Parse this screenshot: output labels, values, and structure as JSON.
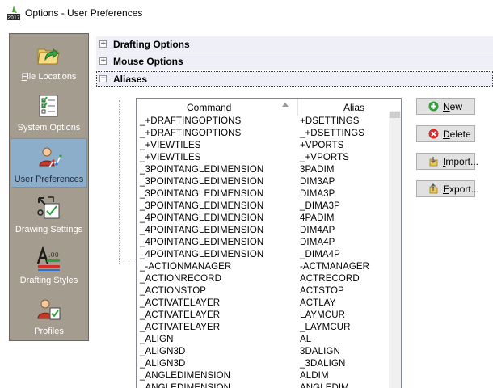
{
  "window": {
    "title": "Options - User Preferences",
    "app_icon_year": "2017",
    "app_icon": "app-logo-icon"
  },
  "sidebar": {
    "items": [
      {
        "label": "File Locations",
        "mnemonic": "F",
        "rest": "ile Locations",
        "icon": "folder-arrow-icon"
      },
      {
        "label": "System Options",
        "mnemonic": "",
        "rest": "System Options",
        "icon": "checklist-icon"
      },
      {
        "label": "User Preferences",
        "mnemonic": "U",
        "rest": "ser Preferences",
        "icon": "user-graph-icon",
        "selected": true
      },
      {
        "label": "Drawing Settings",
        "mnemonic": "",
        "rest": "Drawing Settings",
        "icon": "drawing-settings-icon"
      },
      {
        "label": "Drafting Styles",
        "mnemonic": "",
        "rest": "Drafting Styles",
        "icon": "drafting-styles-icon"
      },
      {
        "label": "Profiles",
        "mnemonic": "P",
        "rest": "rofiles",
        "icon": "profile-icon"
      }
    ]
  },
  "groups": {
    "drafting_options": "Drafting Options",
    "mouse_options": "Mouse Options",
    "aliases": "Aliases",
    "expand_symbol": "+",
    "collapse_symbol": "−"
  },
  "table": {
    "headers": {
      "command": "Command",
      "alias": "Alias"
    },
    "rows": [
      {
        "command": "_+DRAFTINGOPTIONS",
        "alias": "+DSETTINGS"
      },
      {
        "command": "_+DRAFTINGOPTIONS",
        "alias": "_+DSETTINGS"
      },
      {
        "command": "_+VIEWTILES",
        "alias": "+VPORTS"
      },
      {
        "command": "_+VIEWTILES",
        "alias": "_+VPORTS"
      },
      {
        "command": "_3POINTANGLEDIMENSION",
        "alias": "3PADIM"
      },
      {
        "command": "_3POINTANGLEDIMENSION",
        "alias": "DIM3AP"
      },
      {
        "command": "_3POINTANGLEDIMENSION",
        "alias": "DIMA3P"
      },
      {
        "command": "_3POINTANGLEDIMENSION",
        "alias": "_DIMA3P"
      },
      {
        "command": "_4POINTANGLEDIMENSION",
        "alias": "4PADIM"
      },
      {
        "command": "_4POINTANGLEDIMENSION",
        "alias": "DIM4AP"
      },
      {
        "command": "_4POINTANGLEDIMENSION",
        "alias": "DIMA4P"
      },
      {
        "command": "_4POINTANGLEDIMENSION",
        "alias": "_DIMA4P"
      },
      {
        "command": "_-ACTIONMANAGER",
        "alias": "-ACTMANAGER"
      },
      {
        "command": "_ACTIONRECORD",
        "alias": "ACTRECORD"
      },
      {
        "command": "_ACTIONSTOP",
        "alias": "ACTSTOP"
      },
      {
        "command": "_ACTIVATELAYER",
        "alias": "ACTLAY"
      },
      {
        "command": "_ACTIVATELAYER",
        "alias": "LAYMCUR"
      },
      {
        "command": "_ACTIVATELAYER",
        "alias": "_LAYMCUR"
      },
      {
        "command": "_ALIGN",
        "alias": "AL"
      },
      {
        "command": "_ALIGN3D",
        "alias": "3DALIGN"
      },
      {
        "command": "_ALIGN3D",
        "alias": "_3DALIGN"
      },
      {
        "command": "_ANGLEDIMENSION",
        "alias": "ALDIM"
      },
      {
        "command": "_ANGLEDIMENSION",
        "alias": "ANGLEDIM"
      }
    ]
  },
  "buttons": {
    "new": {
      "mnemonic": "N",
      "rest": "ew",
      "label": "New",
      "icon": "add-icon"
    },
    "delete": {
      "mnemonic": "D",
      "rest": "elete",
      "label": "Delete",
      "icon": "delete-icon"
    },
    "import": {
      "mnemonic": "I",
      "rest": "mport...",
      "label": "Import...",
      "icon": "import-icon"
    },
    "export": {
      "mnemonic": "E",
      "rest": "xport...",
      "label": "Export...",
      "icon": "export-icon"
    }
  },
  "colors": {
    "sidebar_bg": "#a49d8f",
    "selected_bg": "#8daecb",
    "group_header_bg": "#eeeff7",
    "add_green": "#2f9e3c",
    "delete_red": "#d92b2b"
  }
}
